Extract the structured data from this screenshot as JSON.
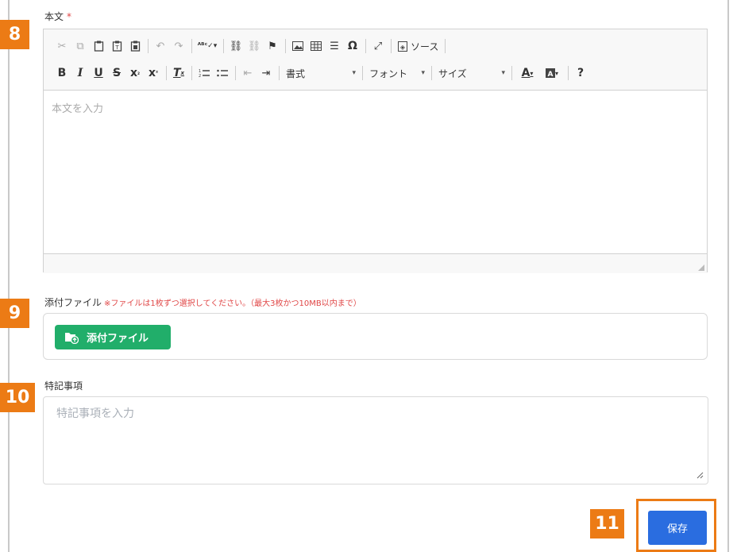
{
  "body_section": {
    "label": "本文",
    "required_mark": "*",
    "placeholder": "本文を入力",
    "toolbar": {
      "source_label": "ソース",
      "format_label": "書式",
      "font_label": "フォント",
      "size_label": "サイズ",
      "help_label": "?"
    }
  },
  "attachment": {
    "label": "添付ファイル",
    "note": "※ファイルは1枚ずつ選択してください。（最大3枚かつ10MB以内まで）",
    "button_label": "添付ファイル"
  },
  "notes": {
    "label": "特記事項",
    "placeholder": "特記事項を入力"
  },
  "save_label": "保存",
  "markers": [
    "8",
    "9",
    "10",
    "11"
  ],
  "colors": {
    "marker": "#ec7b15",
    "attach_button": "#21ae6a",
    "save_button": "#2a6de0",
    "required": "#e04646"
  }
}
